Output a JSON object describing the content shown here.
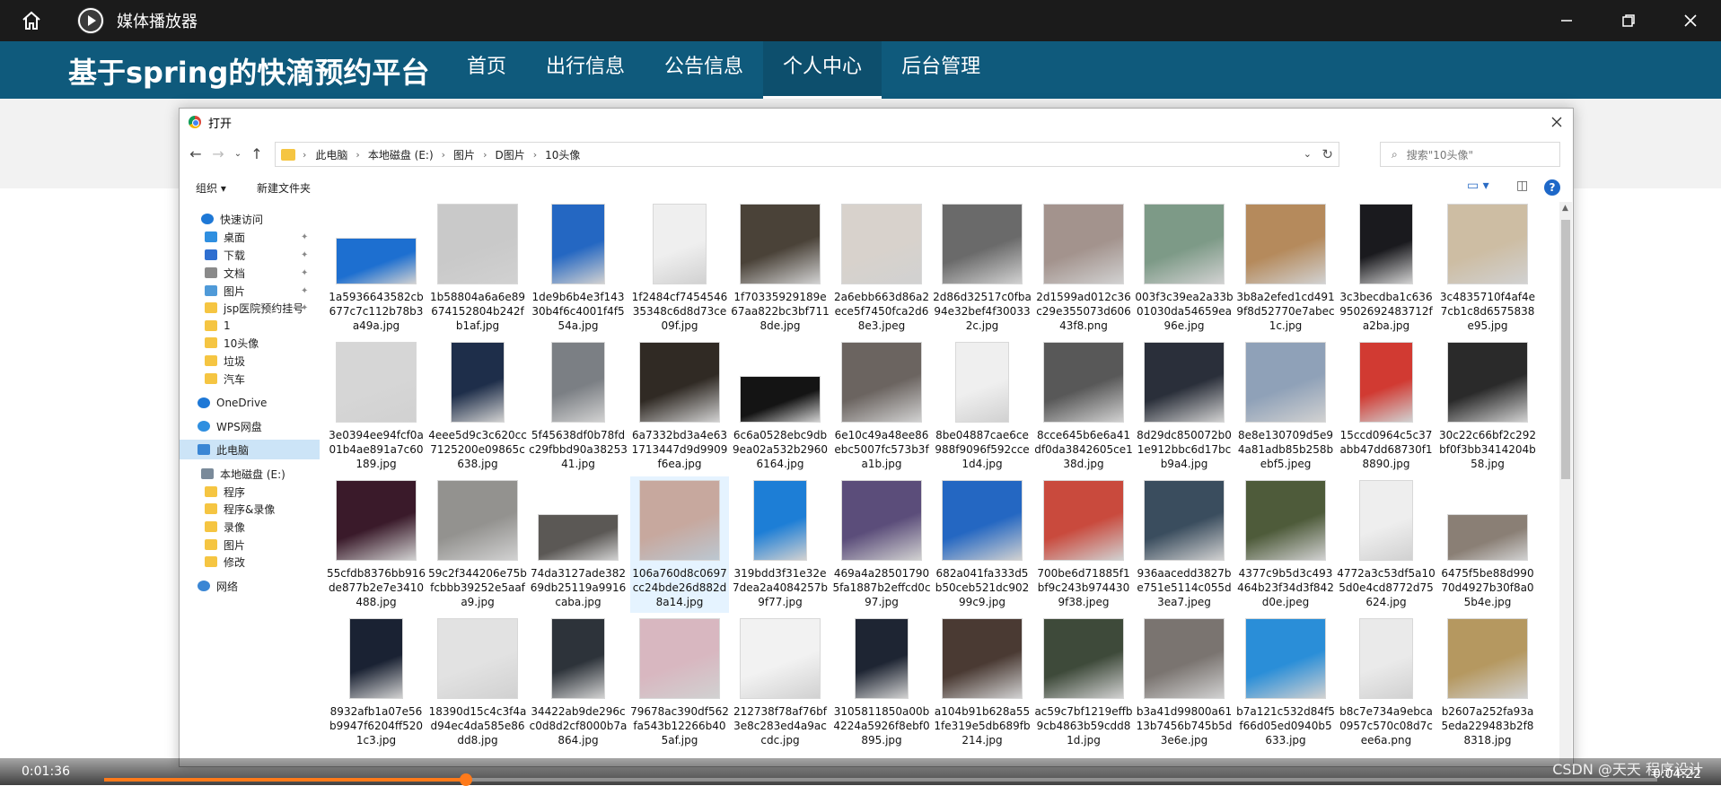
{
  "player": {
    "title": "媒体播放器",
    "time_current": "0:01:36",
    "time_total": "0:04:22",
    "progress": 0.233,
    "watermark": "CSDN @天天 程序设计"
  },
  "site": {
    "title": "基于spring的快滴预约平台",
    "nav": [
      {
        "label": "首页"
      },
      {
        "label": "出行信息"
      },
      {
        "label": "公告信息"
      },
      {
        "label": "个人中心"
      },
      {
        "label": "后台管理"
      }
    ],
    "active_nav": "个人中心"
  },
  "dialog": {
    "title": "打开",
    "breadcrumb": [
      "此电脑",
      "本地磁盘 (E:)",
      "图片",
      "D图片",
      "10头像"
    ],
    "search_placeholder": "搜索\"10头像\"",
    "organize": "组织 ▾",
    "new_folder": "新建文件夹",
    "help": "?",
    "sidebar": [
      {
        "label": "快速访问",
        "icon": "star-icon",
        "color": "#1e78d6",
        "pinned": false
      },
      {
        "label": "桌面",
        "icon": "desktop-icon",
        "color": "#2f8fe0",
        "pinned": true
      },
      {
        "label": "下载",
        "icon": "download-icon",
        "color": "#2f6fd0",
        "pinned": true
      },
      {
        "label": "文档",
        "icon": "document-icon",
        "color": "#8a8a8a",
        "pinned": true
      },
      {
        "label": "图片",
        "icon": "pictures-icon",
        "color": "#4f9ad8",
        "pinned": true
      },
      {
        "label": "jsp医院预约挂号",
        "icon": "folder-icon",
        "color": "#f5c542",
        "pinned": true
      },
      {
        "label": "1",
        "icon": "folder-icon",
        "color": "#f5c542",
        "pinned": false
      },
      {
        "label": "10头像",
        "icon": "folder-icon",
        "color": "#f5c542",
        "pinned": false
      },
      {
        "label": "垃圾",
        "icon": "folder-icon",
        "color": "#f5c542",
        "pinned": false
      },
      {
        "label": "汽车",
        "icon": "folder-icon",
        "color": "#f5c542",
        "pinned": false
      },
      {
        "label": "OneDrive",
        "icon": "cloud-icon",
        "color": "#1e78d6",
        "pinned": false
      },
      {
        "label": "WPS网盘",
        "icon": "cloud-icon",
        "color": "#2f8fe0",
        "pinned": false
      },
      {
        "label": "此电脑",
        "icon": "computer-icon",
        "color": "#3a86d4",
        "pinned": false,
        "selected": true
      },
      {
        "label": "本地磁盘 (E:)",
        "icon": "drive-icon",
        "color": "#7a8a9a",
        "pinned": false
      },
      {
        "label": "程序",
        "icon": "folder-icon",
        "color": "#f5c542",
        "pinned": false
      },
      {
        "label": "程序&录像",
        "icon": "folder-icon",
        "color": "#f5c542",
        "pinned": false
      },
      {
        "label": "录像",
        "icon": "folder-icon",
        "color": "#f5c542",
        "pinned": false
      },
      {
        "label": "图片",
        "icon": "folder-icon",
        "color": "#f5c542",
        "pinned": false
      },
      {
        "label": "修改",
        "icon": "folder-icon",
        "color": "#f5c542",
        "pinned": false
      },
      {
        "label": "网络",
        "icon": "network-icon",
        "color": "#3a86d4",
        "pinned": false
      }
    ],
    "files": [
      {
        "name": "1a5936643582cb677c7c112b78b3a49a.jpg",
        "color": "#1d6fd0",
        "shape": "landscape"
      },
      {
        "name": "1b58804a6a6e89674152804b242fb1af.jpg",
        "color": "#c9c9c9",
        "shape": "square"
      },
      {
        "name": "1de9b6b4e3f14330b4f6c4001f4f554a.jpg",
        "color": "#2467c2",
        "shape": "portrait"
      },
      {
        "name": "1f2484cf745454635348c6d8d73ce09f.jpg",
        "color": "#efefef",
        "shape": "portrait"
      },
      {
        "name": "1f70335929189e67aa822bc3bf7118de.jpg",
        "color": "#4a4238",
        "shape": "square"
      },
      {
        "name": "2a6ebb663d86a2ece5f7450fca2d68e3.jpeg",
        "color": "#d8d2cc",
        "shape": "square"
      },
      {
        "name": "2d86d32517c0fba94e32bef4f300332c.jpg",
        "color": "#6a6a6a",
        "shape": "square"
      },
      {
        "name": "2d1599ad012c36c29e355073d60643f8.png",
        "color": "#a3938d",
        "shape": "square"
      },
      {
        "name": "003f3c39ea2a33b01030da54659ea96e.jpg",
        "color": "#7d9a87",
        "shape": "square"
      },
      {
        "name": "3b8a2efed1cd4919f8d52770e7abec1c.jpg",
        "color": "#b58a5c",
        "shape": "square"
      },
      {
        "name": "3c3becdba1c6369502692483712fa2ba.jpg",
        "color": "#1a1a1e",
        "shape": "portrait"
      },
      {
        "name": "3c4835710f4af4e7cb1c8d6575838e95.jpg",
        "color": "#cdbda3",
        "shape": "square"
      },
      {
        "name": "3e0394ee94fcf0a01b4ae891a7c60189.jpg",
        "color": "#d6d6d6",
        "shape": "square"
      },
      {
        "name": "4eee5d9c3c620cc7125200e09865c638.jpg",
        "color": "#1e2e4a",
        "shape": "portrait"
      },
      {
        "name": "5f45638df0b78fdc29fbbd90a3825341.jpg",
        "color": "#7b7f84",
        "shape": "portrait"
      },
      {
        "name": "6a7332bd3a4e631713447d9d9909f6ea.jpg",
        "color": "#302a24",
        "shape": "square"
      },
      {
        "name": "6c6a0528ebc9db9ea02a532b29606164.jpg",
        "color": "#141414",
        "shape": "landscape"
      },
      {
        "name": "6e10c49a48ee86ebc5007fc573b3fa1b.jpg",
        "color": "#6b6460",
        "shape": "square"
      },
      {
        "name": "8be04887cae6ce988f9096f592cce1d4.jpg",
        "color": "#efefef",
        "shape": "portrait"
      },
      {
        "name": "8cce645b6e6a41df0da3842605ce138d.jpg",
        "color": "#585858",
        "shape": "square"
      },
      {
        "name": "8d29dc850072b01e912bbc6d17bcb9a4.jpg",
        "color": "#2a2f3a",
        "shape": "square"
      },
      {
        "name": "8e8e130709d5e94a81adb85b258bebf5.jpeg",
        "color": "#8fa1b8",
        "shape": "square"
      },
      {
        "name": "15ccd0964c5c37abb47dd68730f18890.jpg",
        "color": "#d13a32",
        "shape": "portrait"
      },
      {
        "name": "30c22c66bf2c292bf0f3bb3414204b58.jpg",
        "color": "#2a2a2a",
        "shape": "square"
      },
      {
        "name": "55cfdb8376bb916de877b2e7e3410488.jpg",
        "color": "#3a1a2a",
        "shape": "square"
      },
      {
        "name": "59c2f344206e75bfcbbb39252e5aafa9.jpg",
        "color": "#93928f",
        "shape": "square"
      },
      {
        "name": "74da3127ade38269db25119a9916caba.jpg",
        "color": "#5b5855",
        "shape": "landscape"
      },
      {
        "name": "106a760d8c0697cc24bde26d882d8a14.jpg",
        "color": "#c7a89e",
        "shape": "square"
      },
      {
        "name": "319bdd3f31e32e7dea2a4084257b9f77.jpg",
        "color": "#1d7ed6",
        "shape": "portrait"
      },
      {
        "name": "469a4a285017905fa1887b2effcd0c97.jpg",
        "color": "#5b4d7a",
        "shape": "square"
      },
      {
        "name": "682a041fa333d5b50ceb521dc90299c9.jpg",
        "color": "#2467c2",
        "shape": "square"
      },
      {
        "name": "700be6d71885f1bf9c243b9744309f38.jpeg",
        "color": "#c94a3d",
        "shape": "square"
      },
      {
        "name": "936aacedd3827be751e5114c055d3ea7.jpeg",
        "color": "#3a4d5e",
        "shape": "square"
      },
      {
        "name": "4377c9b5d3c493464b23f34d3f842d0e.jpeg",
        "color": "#4e5b3a",
        "shape": "square"
      },
      {
        "name": "4772a3c53df5a105d0e4cd8772d75624.jpg",
        "color": "#eeeeee",
        "shape": "portrait"
      },
      {
        "name": "6475f5be88d99070d4927b30f8a05b4e.jpg",
        "color": "#8a7f75",
        "shape": "landscape"
      },
      {
        "name": "8932afb1a07e56b9947f6204ff5201c3.jpg",
        "color": "#1a2233",
        "shape": "portrait"
      },
      {
        "name": "18390d15c4c3f4ad94ec4da585e86dd8.jpg",
        "color": "#e2e2e2",
        "shape": "square"
      },
      {
        "name": "34422ab9de296cc0d8d2cf8000b7a864.jpg",
        "color": "#2d333a",
        "shape": "portrait"
      },
      {
        "name": "79678ac390df562fa543b12266b405af.jpg",
        "color": "#d8b7c0",
        "shape": "square"
      },
      {
        "name": "212738f78af76bf3e8c283ed4a9accdc.jpg",
        "color": "#f2f2f2",
        "shape": "square"
      },
      {
        "name": "3105811850a00b4224a5926f8ebf0895.jpg",
        "color": "#1e2533",
        "shape": "portrait"
      },
      {
        "name": "a104b91b628a551fe319e5db689fb214.jpg",
        "color": "#4a3a33",
        "shape": "square"
      },
      {
        "name": "ac59c7bf1219effb9cb4863b59cdd81d.jpg",
        "color": "#3e4a3a",
        "shape": "square"
      },
      {
        "name": "b3a41d99800a6113b7456b745b5d3e6e.jpg",
        "color": "#7a7470",
        "shape": "square"
      },
      {
        "name": "b7a121c532d84f5f66d05ed0940b5633.jpg",
        "color": "#2a8ed8",
        "shape": "square"
      },
      {
        "name": "b8c7e734a9ebca0957c570c08d7cee6a.png",
        "color": "#eaeaea",
        "shape": "portrait"
      },
      {
        "name": "b2607a252fa93a5eda229483b2f88318.jpg",
        "color": "#b59860",
        "shape": "square"
      }
    ]
  }
}
